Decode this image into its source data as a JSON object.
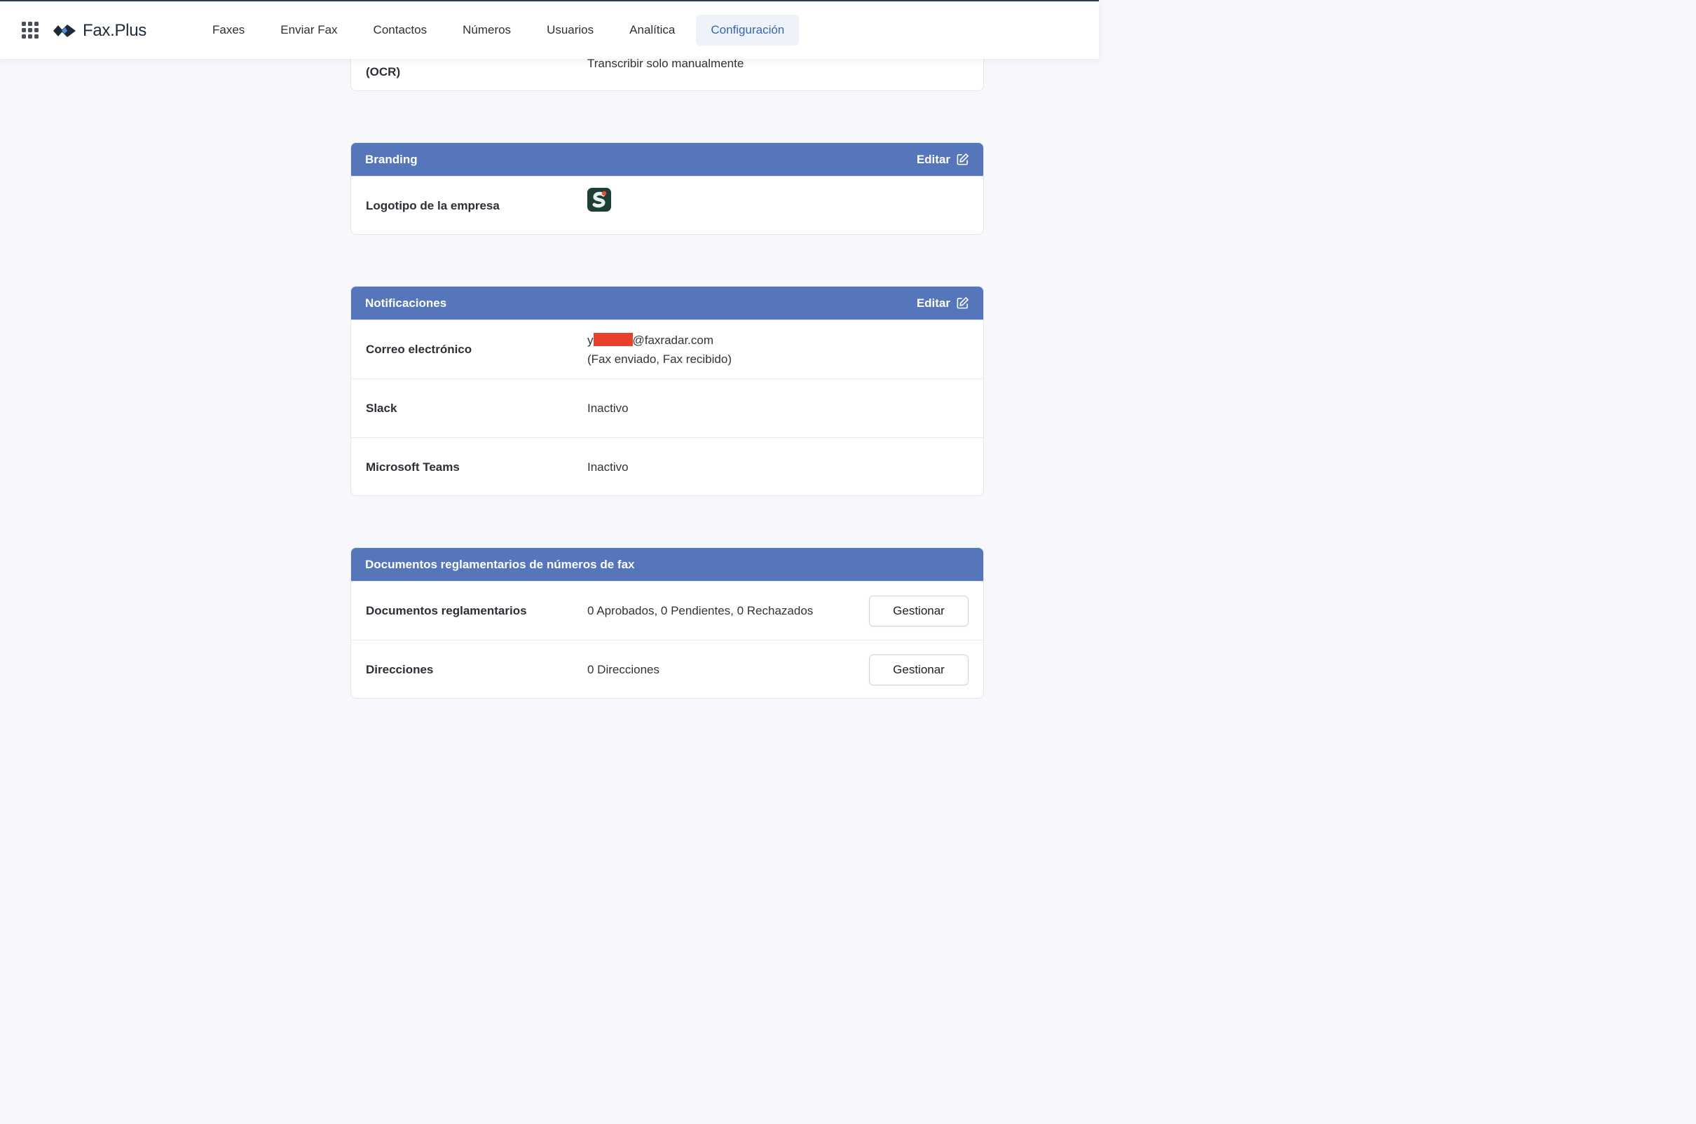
{
  "app": {
    "name": "Fax.Plus"
  },
  "nav": {
    "items": [
      "Faxes",
      "Enviar Fax",
      "Contactos",
      "Números",
      "Usuarios",
      "Analítica",
      "Configuración"
    ],
    "active_index": 6
  },
  "ocr_section": {
    "label": "(OCR)",
    "value": "Transcribir solo manualmente"
  },
  "branding": {
    "title": "Branding",
    "edit_label": "Editar",
    "rows": [
      {
        "label": "Logotipo de la empresa",
        "logo_letter": "S"
      }
    ]
  },
  "notifications": {
    "title": "Notificaciones",
    "edit_label": "Editar",
    "rows": [
      {
        "label": "Correo electrónico",
        "value_prefix": "y",
        "value_suffix": "@faxradar.com",
        "value_detail": "(Fax enviado, Fax recibido)"
      },
      {
        "label": "Slack",
        "value": "Inactivo"
      },
      {
        "label": "Microsoft Teams",
        "value": "Inactivo"
      }
    ]
  },
  "regulatory": {
    "title": "Documentos reglamentarios de números de fax",
    "rows": [
      {
        "label": "Documentos reglamentarios",
        "value": "0 Aprobados, 0 Pendientes, 0 Rechazados",
        "button": "Gestionar"
      },
      {
        "label": "Direcciones",
        "value": "0 Direcciones",
        "button": "Gestionar"
      }
    ]
  },
  "colors": {
    "header_blue": "#5576ba",
    "active_nav": "#3a64b0",
    "redaction": "#e8402a",
    "logo_green": "#1f3f36"
  },
  "icons": [
    "apps-grid-icon",
    "fax-plus-logo-icon",
    "edit-icon",
    "company-logo-icon"
  ]
}
